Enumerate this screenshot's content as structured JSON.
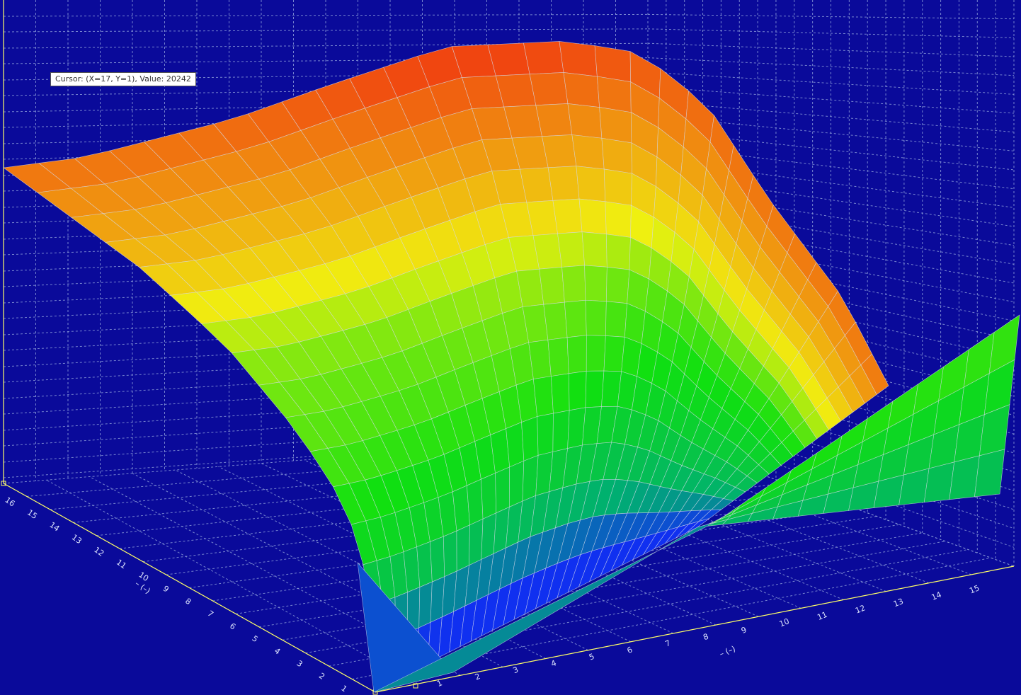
{
  "cursor_label": "Cursor: (X=17, Y=1), Value: 20242",
  "colors": {
    "background": "#0a0a9a",
    "grid": "#8a9ad8",
    "axis": "#ffff66",
    "mesh": "#d8dcea",
    "colormap": [
      "#1030f0",
      "#00b070",
      "#10e010",
      "#f0f010",
      "#f09010",
      "#f02010"
    ]
  },
  "chart_data": {
    "type": "surface",
    "title": "",
    "grid": true,
    "x_axis": {
      "label": "– (–)",
      "ticks": [
        "1",
        "2",
        "3",
        "4",
        "5",
        "6",
        "7",
        "8",
        "9",
        "10",
        "11",
        "12",
        "13",
        "14",
        "15"
      ]
    },
    "y_axis": {
      "label": "– (–)",
      "ticks": [
        "1",
        "2",
        "3",
        "4",
        "5",
        "6",
        "7",
        "8",
        "9",
        "10",
        "11",
        "12",
        "13",
        "14",
        "15",
        "16"
      ]
    },
    "z_axis": {
      "ticks": []
    },
    "cursor": {
      "x": 17,
      "y": 1,
      "value": 20242
    },
    "z_range": [
      0,
      20242
    ]
  }
}
